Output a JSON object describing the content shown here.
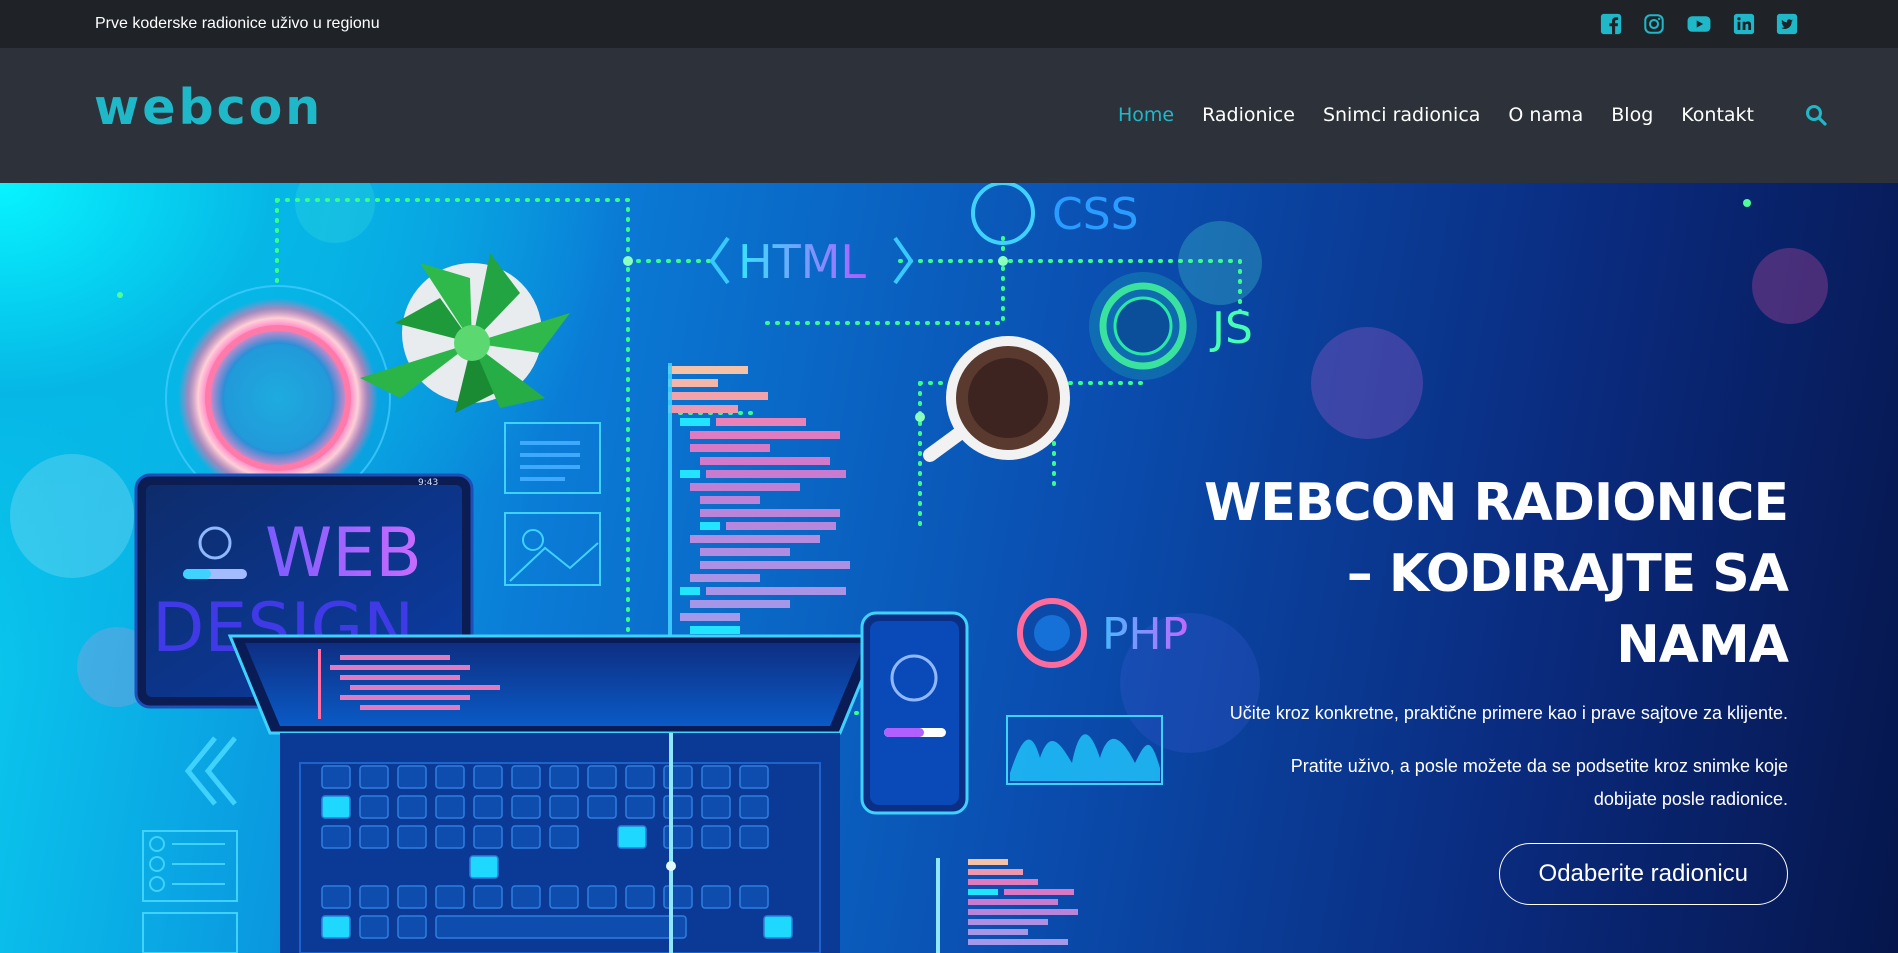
{
  "topbar": {
    "tagline": "Prve koderske radionice uživo u regionu",
    "socials": [
      {
        "icon": "facebook-icon"
      },
      {
        "icon": "instagram-icon"
      },
      {
        "icon": "youtube-icon"
      },
      {
        "icon": "linkedin-icon"
      },
      {
        "icon": "twitter-icon"
      }
    ]
  },
  "header": {
    "logo": "webcon",
    "nav": [
      {
        "label": "Home",
        "active": true
      },
      {
        "label": "Radionice"
      },
      {
        "label": "Snimci radionica"
      },
      {
        "label": "O nama"
      },
      {
        "label": "Blog"
      },
      {
        "label": "Kontakt"
      }
    ],
    "search_icon": "search-icon"
  },
  "hero": {
    "title_line1": "WEBCON RADIONICE",
    "title_line2": "– KODIRAJTE SA",
    "title_line3": "NAMA",
    "subtitle1": "Učite kroz konkretne, praktične primere kao i prave sajtove za klijente.",
    "subtitle2_line1": "Pratite uživo, a posle možete da se podsetite kroz snimke koje",
    "subtitle2_line2": "dobijate posle radionice.",
    "cta_label": "Odaberite radionicu",
    "illustration": {
      "html_label": "HTML",
      "css_label": "CSS",
      "js_label": "JS",
      "php_label": "PHP",
      "tablet_text_1": "WEB",
      "tablet_text_2": "DESIGN",
      "tablet_time": "9:43"
    }
  },
  "colors": {
    "accent": "#1fb8c9",
    "topbar_bg": "#1f2328",
    "header_bg": "#2d323a",
    "text": "#ffffff"
  }
}
